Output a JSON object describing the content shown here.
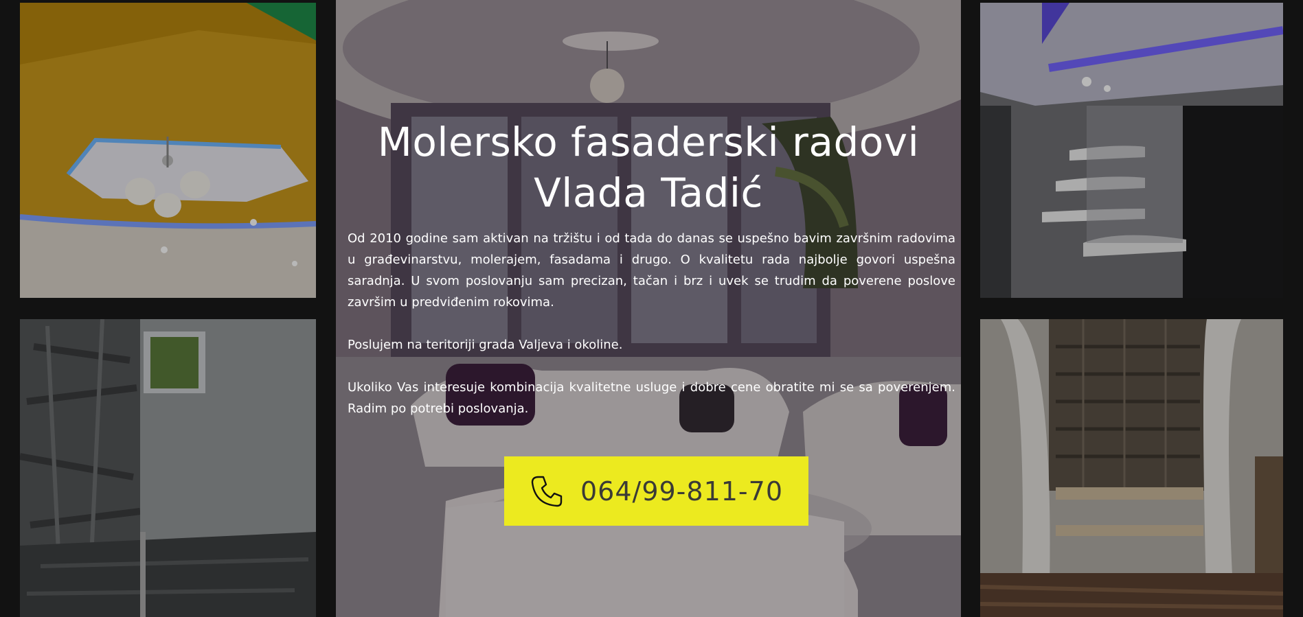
{
  "hero": {
    "title_line1": "Molersko fasaderski radovi",
    "title_line2": "Vlada Tadić",
    "paragraphs": [
      "Od 2010 godine sam aktivan na tržištu i od tada do danas se uspešno bavim završnim radovima u građevinarstvu, molerajem, fasadama i drugo. O kvalitetu rada najbolje govori uspešna saradnja. U svom poslovanju sam precizan, tačan i brz i uvek se trudim da poverene poslove završim u predviđenim rokovima.",
      "Poslujem na teritoriji grada Valjeva i okoline.",
      "Ukoliko Vas interesuje kombinacija kvalitetne usluge i dobre cene obratite mi se sa poverenjem. Radim po potrebi poslovanja."
    ]
  },
  "contact": {
    "phone": "064/99-811-70",
    "icon": "phone-icon",
    "button_color": "#ecea1f"
  },
  "colors": {
    "background": "#121212",
    "text": "#ffffff",
    "phone_text": "#3a3a36"
  }
}
